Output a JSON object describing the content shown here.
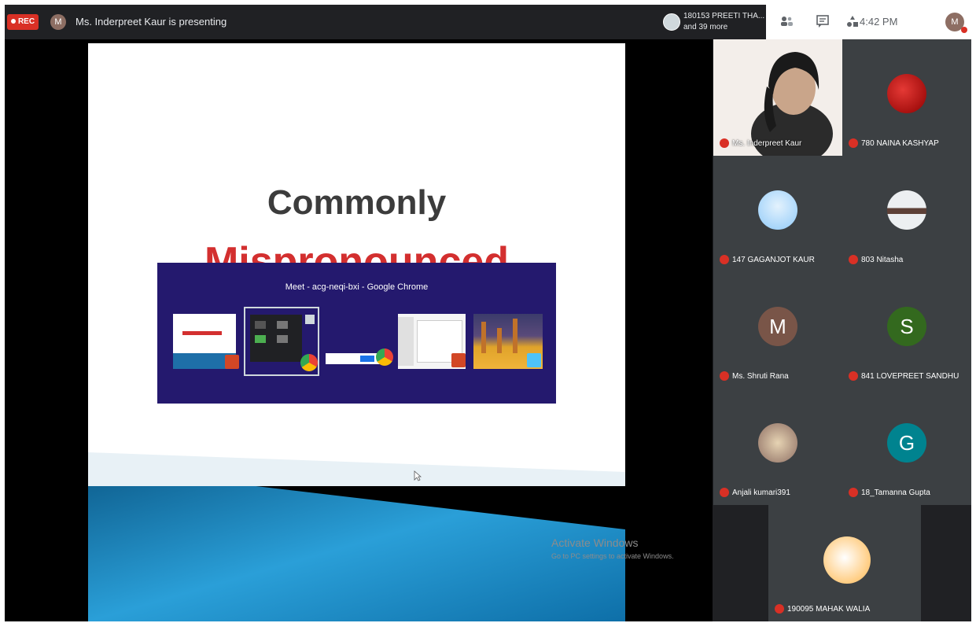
{
  "topbar": {
    "rec_label": "REC",
    "presenter_initial": "M",
    "presenting_text": "Ms. Inderpreet Kaur is presenting",
    "participants_line1": "180153 PREETI THA...",
    "participants_line2": "and 39 more",
    "time": "4:42 PM",
    "self_initial": "M",
    "icons": [
      "people-icon",
      "chat-icon",
      "activities-icon"
    ]
  },
  "slide": {
    "title": "Commonly",
    "red_text": "Mispronounced",
    "colors": {
      "title": "#3c3c3c",
      "red": "#d32f2f",
      "blue_band": "#1e88c8"
    }
  },
  "switcher": {
    "title": "Meet - acg-neqi-bxi - Google Chrome",
    "thumbs": [
      "powerpoint-window",
      "meet-window",
      "chrome-window",
      "powerpoint-slide-window",
      "desktop-window"
    ]
  },
  "watermark": {
    "line1": "Activate Windows",
    "line2": "Go to PC settings to activate Windows."
  },
  "participants": [
    {
      "name": "Ms. Inderpreet Kaur",
      "initial": "",
      "color": "#6d4c41"
    },
    {
      "name": "780 NAINA KASHYAP",
      "initial": "",
      "color": "#c62828"
    },
    {
      "name": "147 GAGANJOT KAUR",
      "initial": "",
      "color": "#90caf9"
    },
    {
      "name": "803 Nitasha",
      "initial": "",
      "color": "#eceff1"
    },
    {
      "name": "Ms. Shruti Rana",
      "initial": "M",
      "color": "#795548"
    },
    {
      "name": "841 LOVEPREET SANDHU",
      "initial": "S",
      "color": "#33691e"
    },
    {
      "name": "Anjali kumari391",
      "initial": "",
      "color": "#a1887f"
    },
    {
      "name": "18_Tamanna Gupta",
      "initial": "G",
      "color": "#00838f"
    },
    {
      "name": "190095 MAHAK WALIA",
      "initial": "",
      "color": "#fff3e0"
    }
  ]
}
